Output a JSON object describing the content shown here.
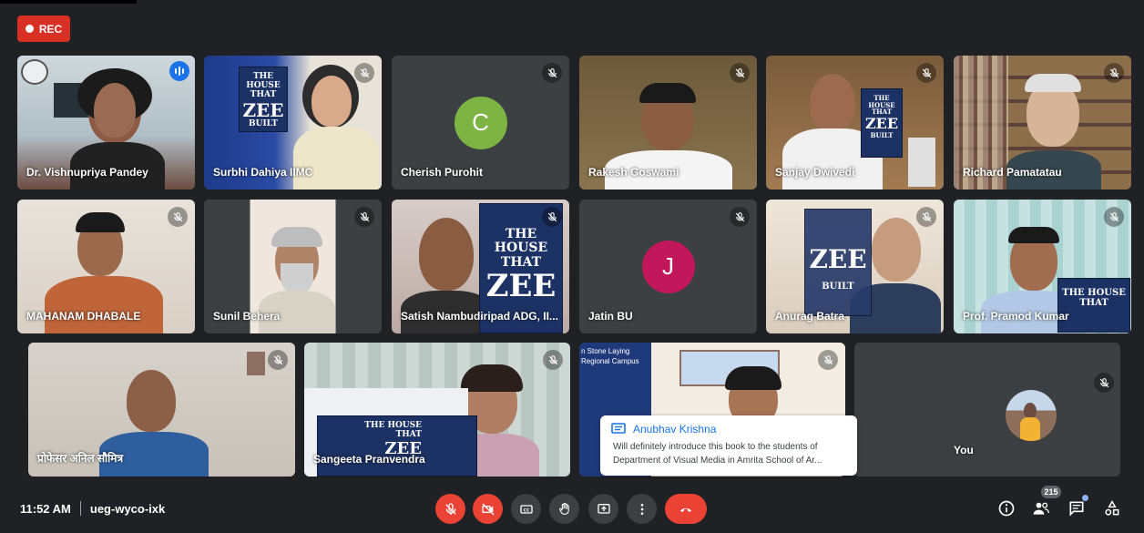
{
  "recording": {
    "label": "REC"
  },
  "participants": [
    {
      "name": "Dr. Vishnupriya Pandey",
      "speaking": true
    },
    {
      "name": "Surbhi Dahiya IIMC"
    },
    {
      "name": "Cherish Purohit",
      "initial": "C",
      "avatar_color": "#7cb342"
    },
    {
      "name": "Rakesh Goswami"
    },
    {
      "name": "Sanjay Dwivedi"
    },
    {
      "name": "Richard Pamatatau"
    },
    {
      "name": "MAHANAM DHABALE"
    },
    {
      "name": "Sunil Behera"
    },
    {
      "name": "Satish Nambudiripad ADG, II..."
    },
    {
      "name": "Jatin BU",
      "initial": "J",
      "avatar_color": "#c2185b"
    },
    {
      "name": "Anurag Batra"
    },
    {
      "name": "Prof. Pramod Kumar"
    },
    {
      "name": "प्रोफेसर अनिल सौमित्र"
    },
    {
      "name": "Sangeeta Pranvendra"
    },
    {
      "name": ""
    },
    {
      "name": ""
    }
  ],
  "books": {
    "title_line1": "THE HOUSE",
    "title_line2": "THAT",
    "title_line3": "ZEE",
    "title_line4": "BUILT"
  },
  "backgrounds": {
    "slide_line1": "n Stone Laying",
    "slide_line2": "Regional Campus"
  },
  "chat_popup": {
    "sender": "Anubhav Krishna",
    "message": "Will definitely introduce this book to the students of Department of Visual Media in Amrita School of Ar..."
  },
  "self_view": {
    "label": "You"
  },
  "meeting": {
    "time": "11:52 AM",
    "code": "ueg-wyco-ixk"
  },
  "participant_count": "215",
  "colors": {
    "accent": "#8ab4f8",
    "danger": "#ea4335",
    "background": "#202124"
  }
}
